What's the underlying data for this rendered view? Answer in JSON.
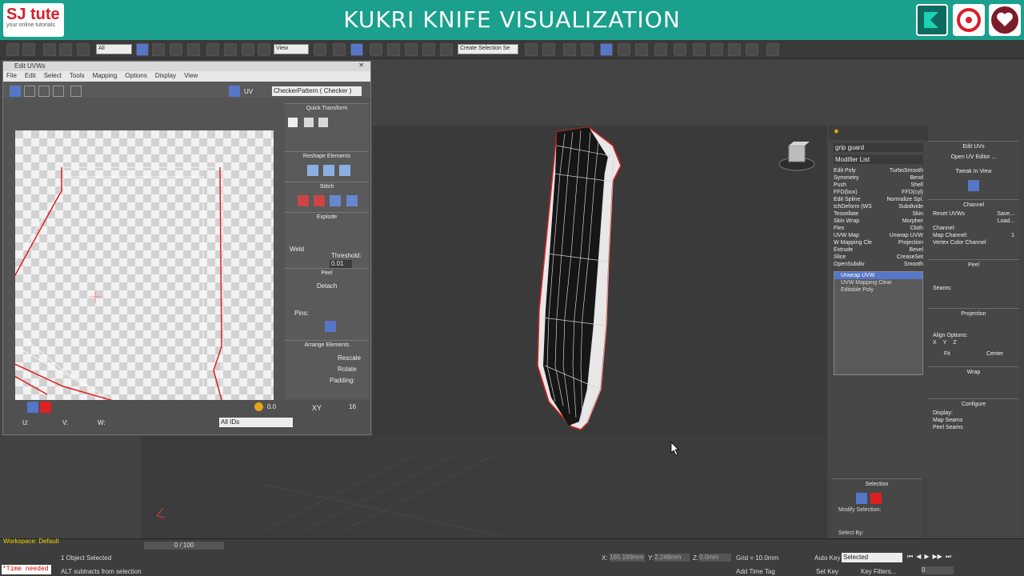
{
  "banner": {
    "title": "KUKRI KNIFE VISUALIZATION",
    "logo_main": "SJ tute",
    "logo_sub": "your online tutorials",
    "icons": [
      "max-icon",
      "share-icon",
      "heart-icon"
    ]
  },
  "toolbar": {
    "filter_value": "All",
    "view_value": "View",
    "selection_set_placeholder": "Create Selection Se"
  },
  "uvw_editor": {
    "title": "Edit UVWs",
    "menu": [
      "File",
      "Edit",
      "Select",
      "Tools",
      "Mapping",
      "Options",
      "Display",
      "View"
    ],
    "uv_label": "UV",
    "texture_value": "CheckerPattern ( Checker )",
    "sections": {
      "quick_transform": "Quick Transform",
      "reshape": "Reshape Elements",
      "stitch": "Stitch",
      "explode": "Explode",
      "weld": "Weld",
      "threshold_label": "Threshold:",
      "threshold_value": "0.01",
      "peel": "Peel",
      "detach": "Detach",
      "pins": "Pins:",
      "arrange": "Arrange Elements",
      "rescale": "Rescale",
      "rotate": "Rotate",
      "padding": "Padding:"
    },
    "bottom": {
      "u_label": "U:",
      "v_label": "V:",
      "w_label": "W:",
      "spinner_value": "0.0",
      "xy_label": "XY",
      "count_value": "16",
      "ids_value": "All IDs"
    }
  },
  "command_panel": {
    "object_name": "grip guard",
    "modifier_list_label": "Modifier List",
    "modifiers": [
      [
        "Edit Poly",
        "TurboSmooth"
      ],
      [
        "Symmetry",
        "Bend"
      ],
      [
        "Push",
        "Shell"
      ],
      [
        "FFD(box)",
        "FFD(cyl)"
      ],
      [
        "Edit Spline",
        "Normalize Spl."
      ],
      [
        "tchDeform (WS",
        "Subdivide"
      ],
      [
        "Tessellate",
        "Skin"
      ],
      [
        "Skin Wrap",
        "Morpher"
      ],
      [
        "Flex",
        "Cloth"
      ],
      [
        "UVW Map",
        "Unwrap UVW"
      ],
      [
        "W Mapping Cle",
        "Projection"
      ],
      [
        "Extrude",
        "Bevel"
      ],
      [
        "Slice",
        "CreaseSet"
      ],
      [
        "OpenSubdiv",
        "Smooth"
      ]
    ],
    "stack": [
      "Unwrap UVW",
      "UVW Mapping Clear",
      "Editable Poly"
    ]
  },
  "selection_panel": {
    "title": "Selection",
    "modify_selection": "Modify Selection:",
    "select_by": "Select By:"
  },
  "right_panel": {
    "edit_uvs": "Edit UVs",
    "open_editor": "Open UV Editor ...",
    "tweak": "Tweak In View",
    "channel": "Channel",
    "reset_uvws": "Reset UVWs",
    "save": "Save...",
    "load": "Load...",
    "channel_label": "Channel:",
    "map_channel": "Map Channel:",
    "map_channel_value": "1",
    "vertex_color": "Vertex Color Channel",
    "peel": "Peel",
    "seams": "Seams:",
    "projection": "Projection",
    "align_options": "Align Options:",
    "axes": [
      "X",
      "Y",
      "Z"
    ],
    "fit": "Fit",
    "center": "Center",
    "wrap": "Wrap",
    "configure": "Configure",
    "display": "Display:",
    "map_seams": "Map Seams",
    "peel_seams": "Peel Seams"
  },
  "status": {
    "workspace": "Workspace: Default",
    "time_needed": "*Time needed",
    "frame": "0 / 100",
    "selected": "1 Object Selected",
    "hint": "ALT subtracts from selection",
    "x_label": "X:",
    "x_value": "165.199mm",
    "y_label": "Y:",
    "y_value": "2.248mm",
    "z_label": "Z:",
    "z_value": "0.0mm",
    "grid": "Grid = 10.0mm",
    "add_time_tag": "Add Time Tag",
    "auto_key": "Auto Key",
    "set_key": "Set Key",
    "selected_value": "Selected",
    "key_filters": "Key Filters...",
    "frame_value": "0"
  },
  "colors": {
    "banner": "#1aa08c",
    "selection_red": "#e02020",
    "highlight_blue": "#5677c8"
  }
}
